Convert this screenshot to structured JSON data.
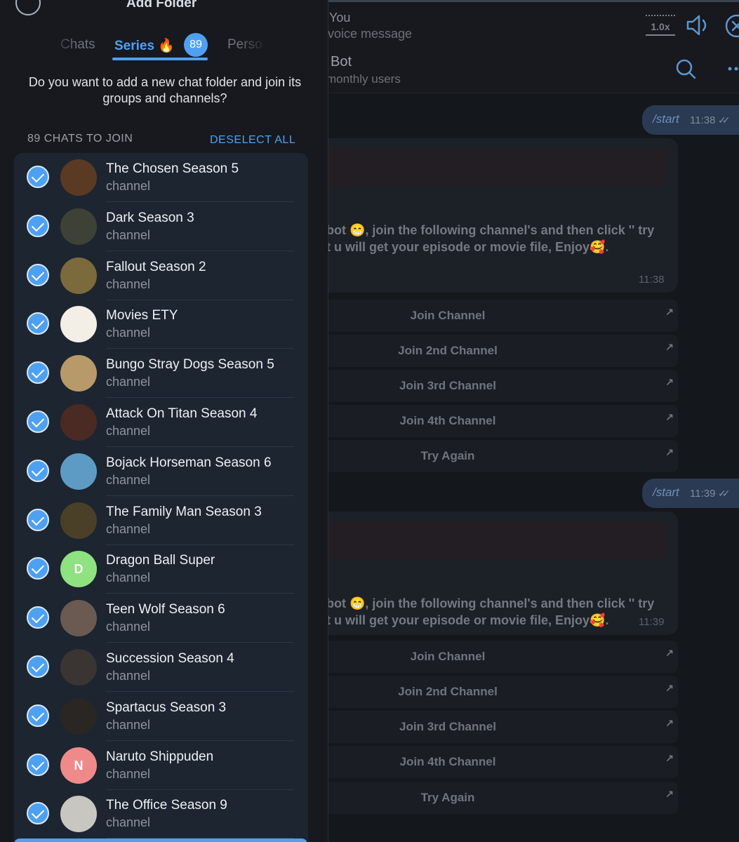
{
  "colors": {
    "accent": "#4ea1f2",
    "panel_bg": "#17191e",
    "list_bg": "#1d2530"
  },
  "audio": {
    "name": "You",
    "subtitle": "voice message",
    "speed": "1.0x"
  },
  "chat": {
    "title": "Bot",
    "subtitle": "monthly users"
  },
  "messages": {
    "out1": {
      "text": "/start",
      "time": "11:38",
      "status": "✓✓"
    },
    "in1": {
      "line1": "bot 😁, join the following channel's and then click '' try",
      "line2": "t u will get your episode or movie file, Enjoy🥰.",
      "time": "11:38"
    },
    "out2": {
      "text": "/start",
      "time": "11:39",
      "status": "✓✓"
    },
    "in2": {
      "line1": "bot 😁, join the following channel's and then click '' try",
      "line2": "t u will get your episode or movie file, Enjoy🥰.",
      "time": "11:39"
    },
    "buttons1": [
      "Join Channel",
      "Join 2nd Channel",
      "Join 3rd Channel",
      "Join 4th Channel",
      "Try Again"
    ],
    "buttons2": [
      "Join Channel",
      "Join 2nd Channel",
      "Join 3rd Channel",
      "Join 4th Channel",
      "Try Again"
    ],
    "button_arrow": "↗"
  },
  "panel": {
    "title": "Add Folder",
    "tabs": [
      {
        "label": "Chats"
      },
      {
        "label": "Series 🔥",
        "badge": "89"
      },
      {
        "label": "Perso"
      }
    ],
    "question": "Do you want to add a new chat folder and join its groups and channels?",
    "count_label": "89 CHATS TO JOIN",
    "deselect_label": "DESELECT ALL",
    "chats": [
      {
        "title": "The Chosen Season 5",
        "sub": "channel",
        "avatar": "#5a3a22"
      },
      {
        "title": "Dark Season 3",
        "sub": "channel",
        "avatar": "#3e4236"
      },
      {
        "title": "Fallout Season 2",
        "sub": "channel",
        "avatar": "#7a6a3c"
      },
      {
        "title": "Movies ETY",
        "sub": "channel",
        "avatar": "#f3efe6"
      },
      {
        "title": "Bungo Stray Dogs Season 5",
        "sub": "channel",
        "avatar": "#b89a6a"
      },
      {
        "title": "Attack On Titan Season 4",
        "sub": "channel",
        "avatar": "#4a2a22"
      },
      {
        "title": "Bojack Horseman Season 6",
        "sub": "channel",
        "avatar": "#5e9bc4"
      },
      {
        "title": "The Family Man Season 3",
        "sub": "channel",
        "avatar": "#4a4028"
      },
      {
        "title": "Dragon Ball Super",
        "sub": "channel",
        "avatar": "#8ee27f",
        "letter": "D"
      },
      {
        "title": "Teen Wolf Season 6",
        "sub": "channel",
        "avatar": "#6a5a52"
      },
      {
        "title": "Succession Season 4",
        "sub": "channel",
        "avatar": "#3a3432"
      },
      {
        "title": "Spartacus Season 3",
        "sub": "channel",
        "avatar": "#2a2624"
      },
      {
        "title": "Naruto Shippuden",
        "sub": "channel",
        "avatar": "#f08a8a",
        "letter": "N"
      },
      {
        "title": "The Office Season 9",
        "sub": "channel",
        "avatar": "#c8c6c0"
      }
    ]
  }
}
